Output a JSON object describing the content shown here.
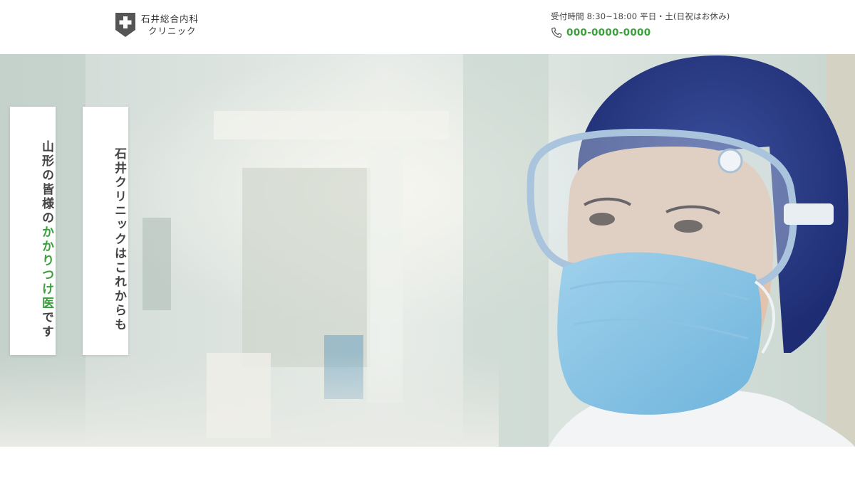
{
  "header": {
    "logo_icon": "medical-cross-shield-icon",
    "logo_line1": "石井総合内科",
    "logo_line2": "クリニック",
    "hours": "受付時間 8:30~18:00 平日・土(日祝はお休み)",
    "phone_icon": "phone-icon",
    "phone": "000-0000-0000",
    "accent_color": "#3aa13a"
  },
  "hero": {
    "tagline_right": "石井クリニックはこれからも",
    "tagline_left_part1": "山形の皆様の",
    "tagline_left_accent": "かかりつけ医",
    "tagline_left_part2": "です"
  }
}
